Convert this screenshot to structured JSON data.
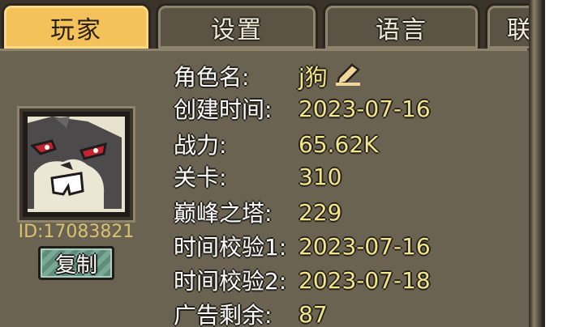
{
  "tabs": [
    {
      "label": "玩家",
      "active": true
    },
    {
      "label": "设置",
      "active": false
    },
    {
      "label": "语言",
      "active": false
    },
    {
      "label": "联",
      "active": false
    }
  ],
  "player": {
    "id_text": "ID:17083821",
    "copy_label": "复制",
    "avatar_icon": "rabbit-avatar-icon",
    "edit_icon": "pencil-icon"
  },
  "info": [
    {
      "label": "角色名:",
      "value": "j狗"
    },
    {
      "label": "创建时间:",
      "value": "2023-07-16"
    },
    {
      "label": "战力:",
      "value": "65.62K"
    },
    {
      "label": "关卡:",
      "value": "310"
    },
    {
      "label": "巅峰之塔:",
      "value": "229"
    },
    {
      "label": "时间校验1:",
      "value": "2023-07-16"
    },
    {
      "label": "时间校验2:",
      "value": "2023-07-18"
    },
    {
      "label": "广告剩余:",
      "value": "87"
    }
  ],
  "colors": {
    "panel": "#6b6352",
    "active_tab": "#f3c25a",
    "value_yellow": "#f3e58a",
    "copy_button": "#79a897"
  }
}
